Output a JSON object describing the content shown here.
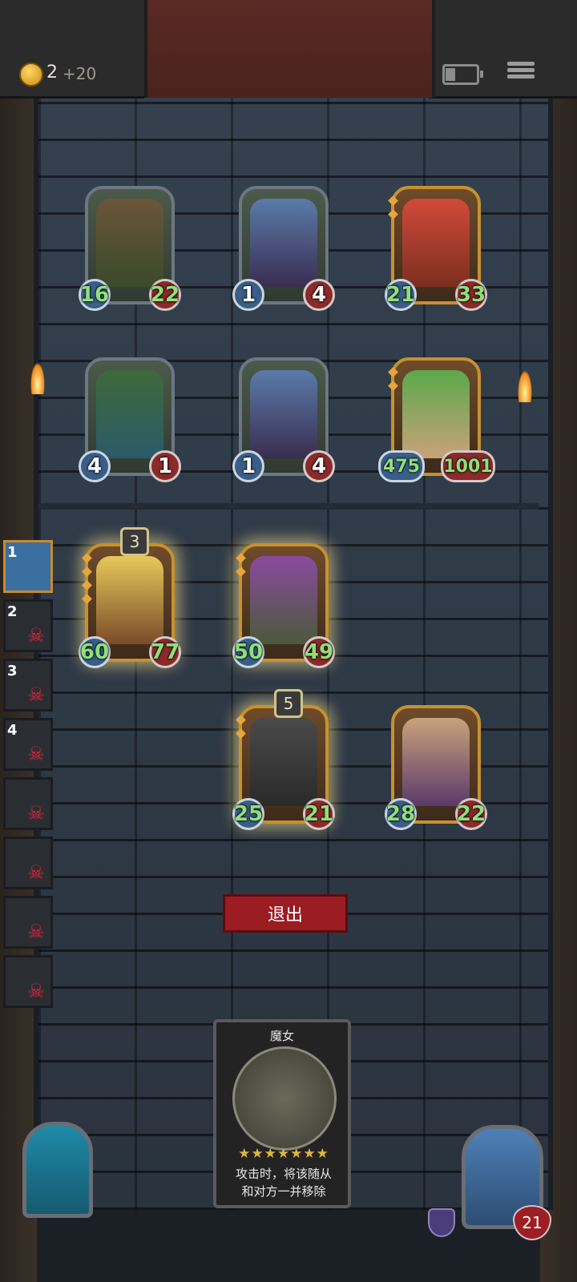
{
  "hud": {
    "coins": "2",
    "coin_bonus": "+20"
  },
  "enemy_board": [
    {
      "name": "mushroom-goblin",
      "attack": "16",
      "health": "22",
      "frame": "silver"
    },
    {
      "name": "blue-elf",
      "attack": "1",
      "health": "4",
      "frame": "silver"
    },
    {
      "name": "red-imp",
      "attack": "21",
      "health": "33",
      "frame": "gold"
    },
    {
      "name": "vine-plant",
      "attack": "4",
      "health": "1",
      "frame": "silver"
    },
    {
      "name": "blue-elf",
      "attack": "1",
      "health": "4",
      "frame": "silver"
    },
    {
      "name": "leaf-girl",
      "attack": "475",
      "health": "1001",
      "frame": "gold"
    }
  ],
  "player_board": [
    {
      "name": "armored-knight",
      "attack": "60",
      "health": "77",
      "tier": "3"
    },
    {
      "name": "brute",
      "attack": "50",
      "health": "49"
    },
    {
      "name": "shield-guard",
      "attack": "25",
      "health": "21",
      "tier": "5"
    },
    {
      "name": "old-gunner",
      "attack": "28",
      "health": "22"
    }
  ],
  "sidebar": [
    {
      "rank": "1",
      "defeated": false
    },
    {
      "rank": "2",
      "defeated": true
    },
    {
      "rank": "3",
      "defeated": true
    },
    {
      "rank": "4",
      "defeated": true
    },
    {
      "rank": "",
      "defeated": true
    },
    {
      "rank": "",
      "defeated": true
    },
    {
      "rank": "",
      "defeated": true
    },
    {
      "rank": "",
      "defeated": true
    }
  ],
  "exit_button": "退出",
  "info_card": {
    "title": "魔女",
    "stars": "★★★★★★★",
    "line1": "攻击时，将该随从",
    "line2": "和对方一并移除"
  },
  "hero": {
    "health": "21"
  },
  "colors": {
    "gold_frame": "#c8902e",
    "silver_frame": "#6d7683",
    "exit_red": "#9b1c22",
    "stat_green": "#8fe07a"
  }
}
